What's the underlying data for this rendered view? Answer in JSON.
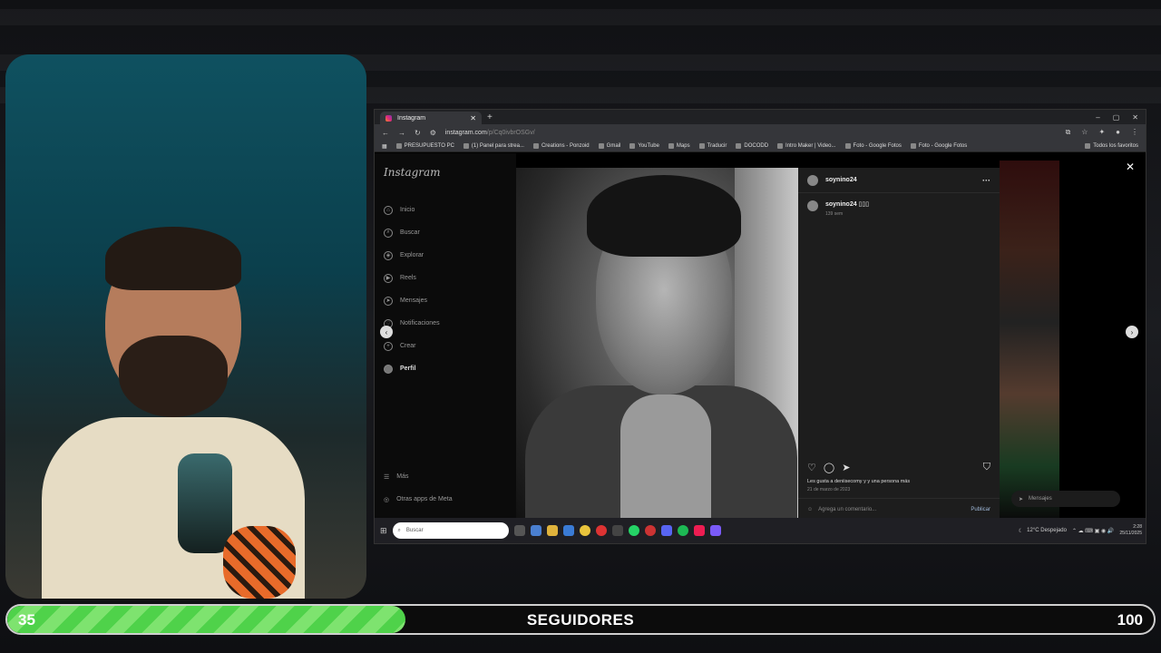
{
  "browser": {
    "tab_title": "Instagram",
    "url_host": "instagram.com",
    "url_path": "/p/Cq0ivbrOSGv/",
    "bookmarks": [
      "PRESUPUESTO PC",
      "(1) Panel para strea...",
      "Creations - Ponzoid",
      "Gmail",
      "YouTube",
      "Maps",
      "Traducir",
      "DOCODD",
      "Intro Maker | Video...",
      "Foto - Google Fotos",
      "Foto - Google Fotos"
    ],
    "all_bookmarks": "Todos los favoritos"
  },
  "instagram": {
    "logo": "Instagram",
    "nav": [
      {
        "label": "Inicio",
        "icon": "home-icon"
      },
      {
        "label": "Buscar",
        "icon": "search-icon"
      },
      {
        "label": "Explorar",
        "icon": "compass-icon"
      },
      {
        "label": "Reels",
        "icon": "reels-icon"
      },
      {
        "label": "Mensajes",
        "icon": "messenger-icon"
      },
      {
        "label": "Notificaciones",
        "icon": "heart-icon"
      },
      {
        "label": "Crear",
        "icon": "plus-icon"
      },
      {
        "label": "Perfil",
        "icon": "avatar-icon"
      }
    ],
    "more": "Más",
    "other_apps": "Otras apps de Meta",
    "post": {
      "username": "soynino24",
      "caption_user": "soynino24",
      "caption_text": "▯▯▯",
      "time_ago": "139 sem",
      "likes_text": "Les gusta a deniisecomy y y una persona más",
      "date": "21 de marzo de 2023",
      "comment_placeholder": "Agrega un comentario...",
      "publish": "Publicar"
    },
    "messages": "Mensajes"
  },
  "taskbar": {
    "search_placeholder": "Buscar",
    "weather": "12°C  Despejado",
    "time": "2:28",
    "date": "25/11/2025"
  },
  "followers": {
    "current": "35",
    "label": "SEGUIDORES",
    "goal": "100",
    "progress": 0.347
  }
}
